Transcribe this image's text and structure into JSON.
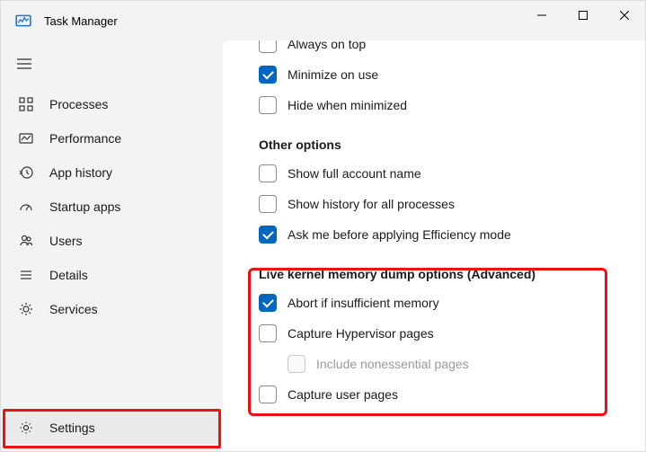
{
  "window": {
    "title": "Task Manager"
  },
  "sidebar": {
    "items": [
      {
        "label": "Processes"
      },
      {
        "label": "Performance"
      },
      {
        "label": "App history"
      },
      {
        "label": "Startup apps"
      },
      {
        "label": "Users"
      },
      {
        "label": "Details"
      },
      {
        "label": "Services"
      }
    ],
    "settings_label": "Settings"
  },
  "options": {
    "always_on_top": {
      "label": "Always on top",
      "checked": false
    },
    "minimize_on_use": {
      "label": "Minimize on use",
      "checked": true
    },
    "hide_when_minimized": {
      "label": "Hide when minimized",
      "checked": false
    }
  },
  "other_options": {
    "title": "Other options",
    "show_full_account_name": {
      "label": "Show full account name",
      "checked": false
    },
    "show_history_all": {
      "label": "Show history for all processes",
      "checked": false
    },
    "ask_efficiency": {
      "label": "Ask me before applying Efficiency mode",
      "checked": true
    }
  },
  "dump_options": {
    "title": "Live kernel memory dump options (Advanced)",
    "abort_insufficient": {
      "label": "Abort if insufficient memory",
      "checked": true
    },
    "capture_hypervisor": {
      "label": "Capture Hypervisor pages",
      "checked": false
    },
    "include_nonessential": {
      "label": "Include nonessential pages",
      "checked": false,
      "disabled": true
    },
    "capture_user": {
      "label": "Capture user pages",
      "checked": false
    }
  }
}
